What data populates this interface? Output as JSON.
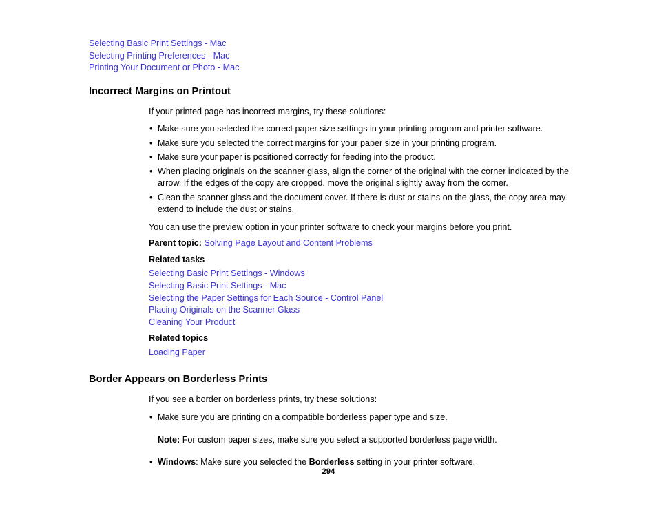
{
  "document": {
    "page_number": "294",
    "link_color": "#3a32d8",
    "text_color": "#000000",
    "background_color": "#ffffff"
  },
  "top_links": [
    {
      "label": "Selecting Basic Print Settings - Mac"
    },
    {
      "label": "Selecting Printing Preferences - Mac"
    },
    {
      "label": "Printing Your Document or Photo - Mac"
    }
  ],
  "section_margins": {
    "heading": "Incorrect Margins on Printout",
    "intro": "If your printed page has incorrect margins, try these solutions:",
    "bullets": [
      "Make sure you selected the correct paper size settings in your printing program and printer software.",
      "Make sure you selected the correct margins for your paper size in your printing program.",
      "Make sure your paper is positioned correctly for feeding into the product.",
      "When placing originals on the scanner glass, align the corner of the original with the corner indicated by the arrow. If the edges of the copy are cropped, move the original slightly away from the corner.",
      "Clean the scanner glass and the document cover. If there is dust or stains on the glass, the copy area may extend to include the dust or stains."
    ],
    "closing": "You can use the preview option in your printer software to check your margins before you print.",
    "parent_topic_label": "Parent topic:",
    "parent_topic_link": "Solving Page Layout and Content Problems",
    "related_tasks_label": "Related tasks",
    "related_tasks": [
      {
        "label": "Selecting Basic Print Settings - Windows"
      },
      {
        "label": "Selecting Basic Print Settings - Mac"
      },
      {
        "label": "Selecting the Paper Settings for Each Source - Control Panel"
      },
      {
        "label": "Placing Originals on the Scanner Glass"
      },
      {
        "label": "Cleaning Your Product"
      }
    ],
    "related_topics_label": "Related topics",
    "related_topics": [
      {
        "label": "Loading Paper"
      }
    ]
  },
  "section_borderless": {
    "heading": "Border Appears on Borderless Prints",
    "intro": "If you see a border on borderless prints, try these solutions:",
    "bullet_1": "Make sure you are printing on a compatible borderless paper type and size.",
    "note_label": "Note:",
    "note_text": "For custom paper sizes, make sure you select a supported borderless page width.",
    "bullet_2_platform": "Windows",
    "bullet_2_part1": ": Make sure you selected the ",
    "bullet_2_emphasis": "Borderless",
    "bullet_2_part2": " setting in your printer software."
  }
}
